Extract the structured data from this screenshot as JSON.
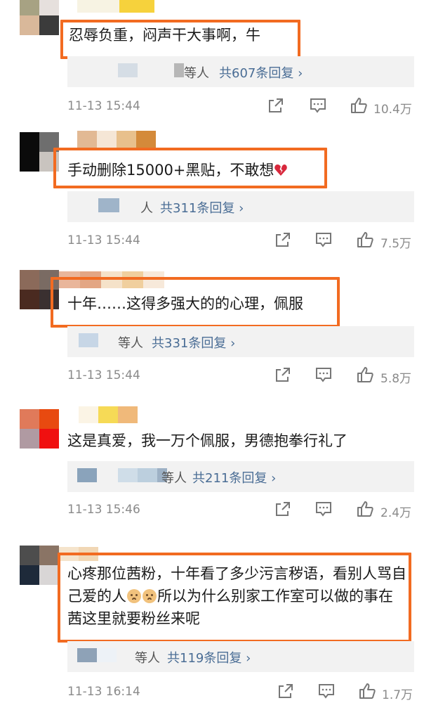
{
  "comments": [
    {
      "text": "忍辱负重，闷声干大事啊，牛",
      "reply_prefix": "等人",
      "reply_link": "共607条回复 ›",
      "time": "11-13 15:44",
      "likes": "10.4万"
    },
    {
      "text": "手动删除15000+黑贴，不敢想",
      "reply_prefix": "人",
      "reply_link": "共311条回复 ›",
      "time": "11-13 15:44",
      "likes": "7.5万"
    },
    {
      "text": "十年……这得多强大的的心理，佩服",
      "reply_prefix": "等人",
      "reply_link": "共331条回复 ›",
      "time": "11-13 15:44",
      "likes": "5.8万"
    },
    {
      "text": "这是真爱，我一万个佩服，男德抱拳行礼了",
      "reply_prefix": "等人",
      "reply_link": "共211条回复 ›",
      "time": "11-13 15:46",
      "likes": "2.4万"
    },
    {
      "text_part1": "心疼那位茜粉，十年看了多少污言秽语，看别人骂自己爱的人",
      "text_part2": "所以为什么别家工作室可以做的事在茜这里就要粉丝来呢",
      "reply_prefix": "等人",
      "reply_link": "共119条回复 ›",
      "time": "11-13 16:14",
      "likes": "1.7万"
    }
  ],
  "icons": {
    "share": "share-icon",
    "comment": "comment-icon",
    "like": "thumbs-up-icon",
    "heart": "broken-heart-emoji",
    "emoji": "sad-face-emoji"
  },
  "colors": {
    "highlight": "#f26b21",
    "link": "#4a6d95",
    "meta": "#8a8a8a"
  }
}
